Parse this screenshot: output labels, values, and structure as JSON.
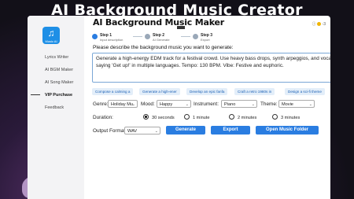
{
  "banner": {
    "title": "AI Background Music  Creator"
  },
  "app": {
    "title": "AI Background Music Maker",
    "logo_text": "Music AI",
    "tooltip": ""
  },
  "sidebar": {
    "items": [
      {
        "label": "Lyrics Writer"
      },
      {
        "label": "AI BGM Maker"
      },
      {
        "label": "AI Song Maker"
      },
      {
        "label": "VIP Purchase"
      },
      {
        "label": "Feedback"
      }
    ]
  },
  "topbar": {
    "coin_count": "-3"
  },
  "steps": [
    {
      "name": "Step 1",
      "sub": "Input description"
    },
    {
      "name": "Step 2",
      "sub": "AI Generate"
    },
    {
      "name": "Step 3",
      "sub": "Export"
    }
  ],
  "prompt": {
    "label": "Please describe the background music you want to generate:",
    "value": "Generate a high-energy EDM track for a festival crowd. Use heavy bass drops, synth arpeggios, and vocal chops saying 'Get up!' in multiple languages. Tempo: 130 BPM. Vibe: Festive and euphoric."
  },
  "suggestions": [
    "Compose a calming a",
    "Generate a high-ener",
    "Develop an epic fanfa",
    "Craft a retro 1980s in",
    "Design a sci-fi theme"
  ],
  "options": {
    "genre_label": "Genre:",
    "genre_value": "Holiday Mu",
    "mood_label": "Mood:",
    "mood_value": "Happy",
    "instrument_label": "Instrument:",
    "instrument_value": "Piano",
    "theme_label": "Theme:",
    "theme_value": "Movie"
  },
  "duration": {
    "label": "Duration:",
    "choices": [
      "30 seconds",
      "1 minute",
      "2 minutes",
      "3 minutes"
    ],
    "selected": "30 seconds"
  },
  "output": {
    "label": "Output Format:",
    "format_value": "WAV",
    "generate_label": "Generate",
    "export_label": "Export",
    "open_folder_label": "Open Music Folder"
  },
  "colors": {
    "accent": "#2a7de1",
    "chip_bg": "#e3eef9",
    "chip_text": "#1a5fb4"
  }
}
